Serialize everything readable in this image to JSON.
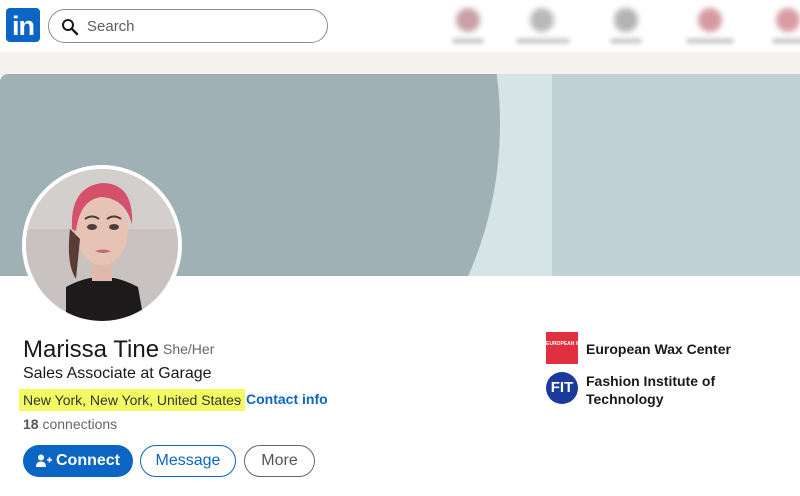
{
  "nav": {
    "logo_text": "in",
    "search_placeholder": "Search",
    "blurred_icons": [
      "#e88f97",
      "#b9b9b9",
      "#b3b3b3",
      "#e98f98",
      "#e8939a"
    ]
  },
  "profile": {
    "name": "Marissa Tine",
    "pronouns": "She/Her",
    "headline": "Sales Associate at Garage",
    "location": "New York, New York, United States",
    "separator": "·",
    "contact_info": "Contact info",
    "connections_count": "18",
    "connections_label": "connections"
  },
  "actions": {
    "connect": "Connect",
    "message": "Message",
    "more": "More"
  },
  "experience": [
    {
      "name": "European Wax Center",
      "logo_text": "EUROPEAN WAX CENTER"
    },
    {
      "name_line1": "Fashion Institute of",
      "name_line2": "Technology",
      "logo_text": "FIT"
    }
  ],
  "colors": {
    "brand_blue": "#0a66c2",
    "highlight": "#f3fb63"
  }
}
